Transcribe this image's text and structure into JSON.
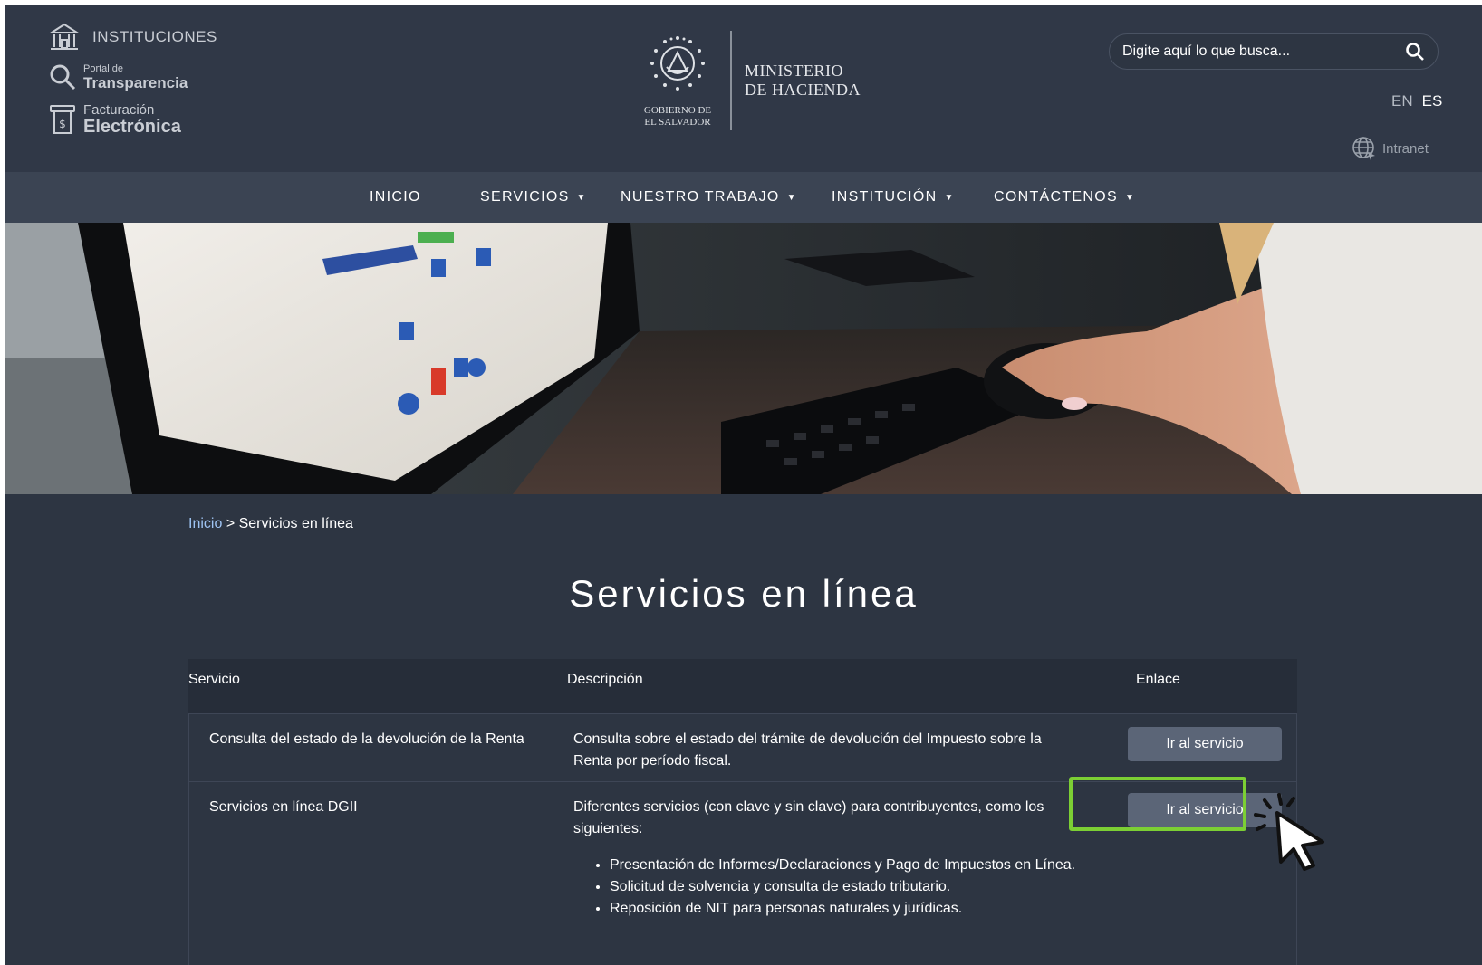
{
  "header": {
    "institutions_label": "INSTITUCIONES",
    "transparency_small": "Portal de",
    "transparency_big": "Transparencia",
    "billing_small": "Facturación",
    "billing_big": "Electrónica",
    "gov_line1": "GOBIERNO DE",
    "gov_line2": "EL SALVADOR",
    "ministry_line1": "MINISTERIO",
    "ministry_line2": "DE HACIENDA",
    "search_placeholder": "Digite aquí lo que busca...",
    "lang_en": "EN",
    "lang_es": "ES",
    "intranet": "Intranet"
  },
  "nav": {
    "items": [
      {
        "label": "INICIO"
      },
      {
        "label": "SERVICIOS"
      },
      {
        "label": "NUESTRO TRABAJO"
      },
      {
        "label": "INSTITUCIÓN"
      },
      {
        "label": "CONTÁCTENOS"
      }
    ]
  },
  "breadcrumb": {
    "home": "Inicio",
    "separator": ">",
    "current": "Servicios en línea"
  },
  "page_title": "Servicios en línea",
  "table": {
    "headers": {
      "service": "Servicio",
      "description": "Descripción",
      "link": "Enlace"
    },
    "rows": [
      {
        "service": "Consulta del estado de la devolución de la Renta",
        "description": "Consulta sobre el estado del trámite de devolución del Impuesto sobre la Renta por período fiscal.",
        "button": "Ir al servicio"
      },
      {
        "service": "Servicios en línea DGII",
        "description": "Diferentes servicios (con clave y sin clave) para contribuyentes, como los siguientes:",
        "bullets": [
          "Presentación de Informes/Declaraciones y Pago de Impuestos en Línea.",
          "Solicitud de solvencia y consulta de estado tributario.",
          "Reposición de NIT para personas naturales y jurídicas."
        ],
        "button": "Ir al servicio"
      }
    ]
  },
  "colors": {
    "page_background": "#2d3542",
    "header_background": "#303847",
    "nav_background": "#3b4453",
    "button": "#5b6577",
    "highlight": "#7ccf34",
    "link": "#9ec3f2"
  }
}
